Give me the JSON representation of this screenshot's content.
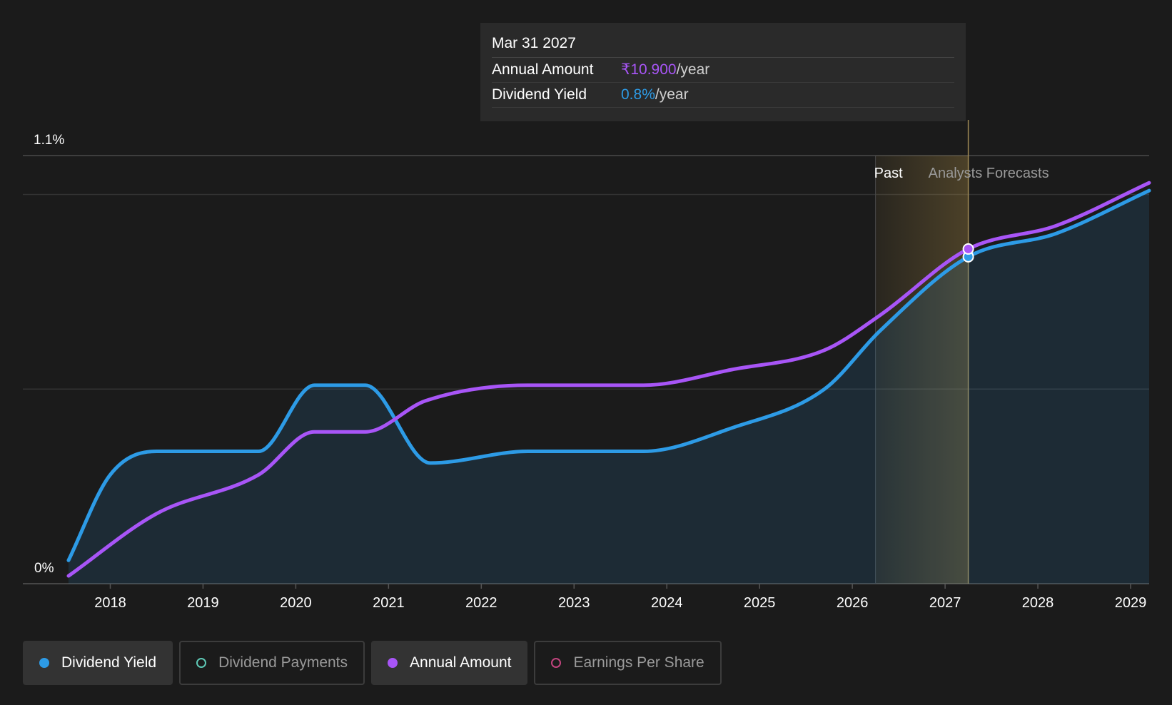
{
  "tooltip": {
    "date": "Mar 31 2027",
    "rows": [
      {
        "label": "Annual Amount",
        "value": "₹10.900",
        "unit": "/year",
        "color": "#a855f7"
      },
      {
        "label": "Dividend Yield",
        "value": "0.8%",
        "unit": "/year",
        "color": "#2d9be6"
      }
    ]
  },
  "legend": [
    {
      "label": "Dividend Yield",
      "color": "#2d9be6",
      "state": "active",
      "marker": "filled"
    },
    {
      "label": "Dividend Payments",
      "color": "#5ec9b6",
      "state": "inactive",
      "marker": "hollow"
    },
    {
      "label": "Annual Amount",
      "color": "#a855f7",
      "state": "active",
      "marker": "filled"
    },
    {
      "label": "Earnings Per Share",
      "color": "#c2447e",
      "state": "inactive",
      "marker": "hollow"
    }
  ],
  "chart_data": {
    "type": "area",
    "ylim": [
      0,
      1.1
    ],
    "ytick_labels": [
      "0%",
      "1.1%"
    ],
    "xlim": [
      2017.55,
      2029.2
    ],
    "xticks": [
      2018,
      2019,
      2020,
      2021,
      2022,
      2023,
      2024,
      2025,
      2026,
      2027,
      2028,
      2029
    ],
    "regions": {
      "past_label": "Past",
      "forecast_label": "Analysts Forecasts",
      "past_start": 2026.25,
      "cursor": 2027.25
    },
    "grid": true,
    "series": [
      {
        "name": "Dividend Yield",
        "color": "#2d9be6",
        "points": [
          [
            2017.55,
            0.06
          ],
          [
            2018.0,
            0.28
          ],
          [
            2018.5,
            0.34
          ],
          [
            2019.6,
            0.34
          ],
          [
            2020.2,
            0.51
          ],
          [
            2020.75,
            0.51
          ],
          [
            2021.45,
            0.31
          ],
          [
            2022.5,
            0.34
          ],
          [
            2023.75,
            0.34
          ],
          [
            2024.7,
            0.4
          ],
          [
            2025.7,
            0.5
          ],
          [
            2026.3,
            0.65
          ],
          [
            2027.25,
            0.84
          ],
          [
            2028.2,
            0.9
          ],
          [
            2029.2,
            1.01
          ]
        ]
      },
      {
        "name": "Annual Amount",
        "color": "#a855f7",
        "points": [
          [
            2017.55,
            0.02
          ],
          [
            2018.5,
            0.18
          ],
          [
            2019.6,
            0.28
          ],
          [
            2020.2,
            0.39
          ],
          [
            2020.75,
            0.39
          ],
          [
            2021.4,
            0.47
          ],
          [
            2022.5,
            0.51
          ],
          [
            2023.75,
            0.51
          ],
          [
            2024.7,
            0.55
          ],
          [
            2025.7,
            0.6
          ],
          [
            2026.3,
            0.69
          ],
          [
            2027.25,
            0.86
          ],
          [
            2028.2,
            0.92
          ],
          [
            2029.2,
            1.03
          ]
        ]
      }
    ]
  }
}
